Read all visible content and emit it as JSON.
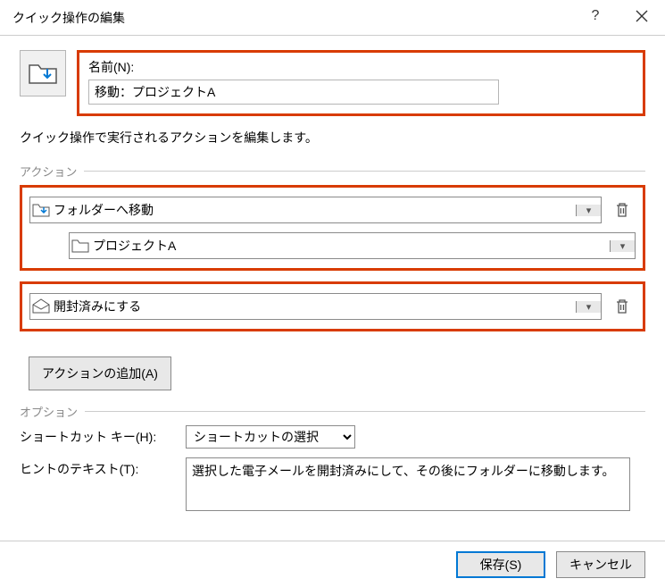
{
  "window": {
    "title": "クイック操作の編集"
  },
  "name": {
    "label": "名前(N):",
    "value": "移動：プロジェクトA"
  },
  "description": "クイック操作で実行されるアクションを編集します。",
  "sections": {
    "actions": "アクション",
    "options": "オプション"
  },
  "actions": [
    {
      "label": "フォルダーへ移動",
      "subfolder": "プロジェクトA"
    },
    {
      "label": "開封済みにする"
    }
  ],
  "add_action_label": "アクションの追加(A)",
  "options": {
    "shortcut_label": "ショートカット キー(H):",
    "shortcut_value": "ショートカットの選択",
    "hint_label": "ヒントのテキスト(T):",
    "hint_value": "選択した電子メールを開封済みにして、その後にフォルダーに移動します。"
  },
  "buttons": {
    "save": "保存(S)",
    "cancel": "キャンセル"
  }
}
